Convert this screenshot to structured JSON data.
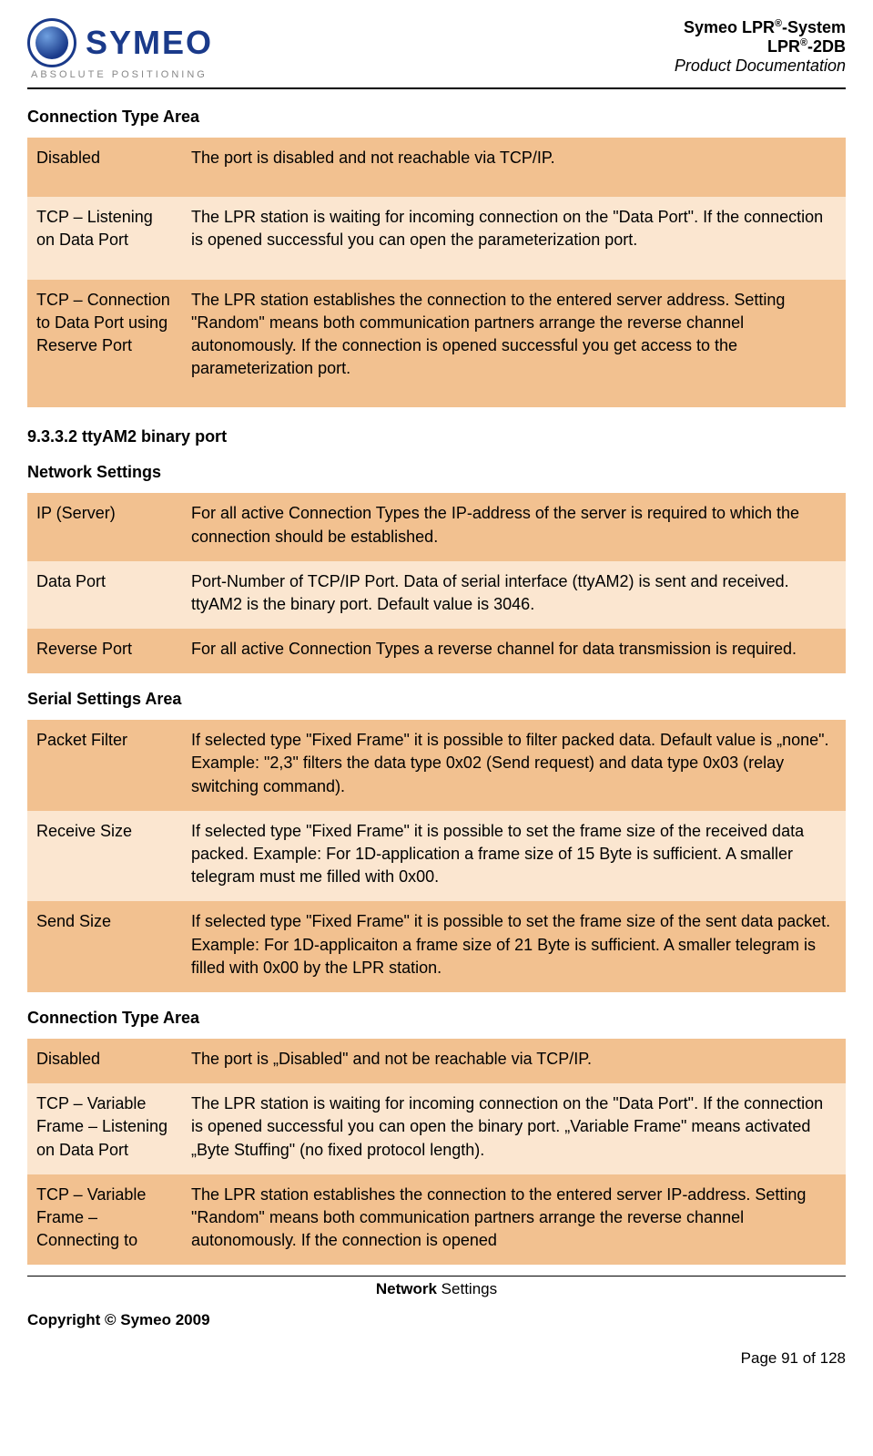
{
  "header": {
    "logo_text": "SYMEO",
    "logo_sub": "ABSOLUTE POSITIONING",
    "line1_pre": "Symeo LPR",
    "line1_sup": "®",
    "line1_post": "-System",
    "line2_pre": "LPR",
    "line2_sup": "®",
    "line2_post": "-2DB",
    "line3": "Product Documentation"
  },
  "sections": {
    "s1_title": "Connection Type Area",
    "s1_rows": [
      {
        "k": "Disabled",
        "v": "The port is disabled and not reachable via TCP/IP."
      },
      {
        "k": "TCP – Listening on Data Port",
        "v": "The LPR station is waiting for incoming connection on the \"Data Port\". If the connection is opened successful you can open the parameterization port."
      },
      {
        "k": "TCP – Connection to Data Port using Reserve Port",
        "v": "The LPR station establishes the connection to the entered server address. Setting \"Random\" means both communication partners arrange the reverse channel autonomously. If the connection is opened successful you get access to the parameterization port."
      }
    ],
    "s2_heading": "9.3.3.2   ttyAM2 binary port",
    "s3_title": "Network Settings",
    "s3_rows": [
      {
        "k": "IP (Server)",
        "v": "For all active Connection Types the IP-address of the server is required to which the connection should be established."
      },
      {
        "k": "Data Port",
        "v": "Port-Number of TCP/IP Port. Data of serial interface (ttyAM2) is sent and received. ttyAM2 is the binary port. Default value is 3046."
      },
      {
        "k": "Reverse Port",
        "v": "For all active Connection Types a reverse channel for data transmission is required."
      }
    ],
    "s4_title": "Serial Settings Area",
    "s4_rows": [
      {
        "k": "Packet Filter",
        "v": "If selected type \"Fixed Frame\" it is possible to filter packed data. Default value is „none\". Example: \"2,3\" filters the data type 0x02 (Send request) and data type 0x03 (relay switching command)."
      },
      {
        "k": "Receive Size",
        "v": "If selected type \"Fixed Frame\" it is possible to set the frame size of the received data packed. Example: For 1D-application a frame size of 15 Byte is sufficient. A smaller telegram must me filled with 0x00."
      },
      {
        "k": "Send Size",
        "v": "If selected type \"Fixed Frame\" it is possible to set the frame size of the sent data packet. Example: For 1D-applicaiton a frame size of 21 Byte is sufficient. A smaller telegram is filled with 0x00 by the LPR station."
      }
    ],
    "s5_title": "Connection Type Area",
    "s5_rows": [
      {
        "k": "Disabled",
        "v": "The port is „Disabled\" and not be reachable via TCP/IP."
      },
      {
        "k": "TCP – Variable Frame – Listening on Data Port",
        "v": "The LPR station is waiting for incoming connection on the \"Data Port\". If the connection is opened successful you can open the binary port. „Variable Frame\" means activated „Byte Stuffing\" (no fixed protocol length)."
      },
      {
        "k": "TCP – Variable Frame – Connecting to",
        "v": "The LPR station establishes the connection to the entered server IP-address. Setting \"Random\" means both communication partners arrange the reverse channel autonomously. If the connection is opened"
      }
    ]
  },
  "footer": {
    "center_bold": "Network",
    "center_rest": " Settings",
    "copyright": "Copyright © Symeo 2009",
    "pagenum": "Page 91 of 128"
  }
}
